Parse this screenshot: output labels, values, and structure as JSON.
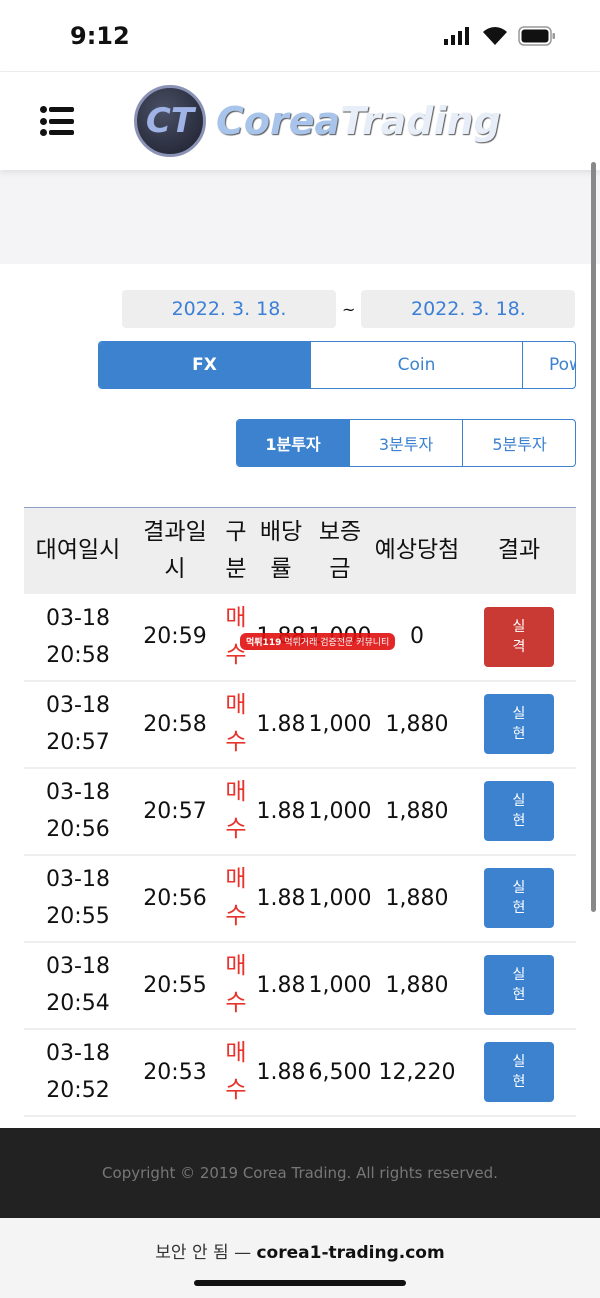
{
  "status": {
    "time": "9:12"
  },
  "header": {
    "logo_mark": "CT",
    "brand_a": "Corea",
    "brand_b": "Trading"
  },
  "dates": {
    "from": "2022. 3. 18.",
    "sep": "~",
    "to": "2022. 3. 18."
  },
  "tabs": [
    {
      "label": "FX",
      "active": true
    },
    {
      "label": "Coin"
    },
    {
      "label": "Pow"
    }
  ],
  "subtabs": [
    {
      "label": "1분투자",
      "active": true
    },
    {
      "label": "3분투자"
    },
    {
      "label": "5분투자"
    }
  ],
  "table": {
    "headers": [
      "대여일시",
      "결과일시",
      "구분",
      "배당률",
      "보증금",
      "예상당첨",
      "결과"
    ],
    "rows": [
      {
        "date": "03-18",
        "time": "20:58",
        "result_time": "20:59",
        "type": "매수",
        "rate": "1.88",
        "deposit": "1,000",
        "expected": "0",
        "result": "실격",
        "status": "fail"
      },
      {
        "date": "03-18",
        "time": "20:57",
        "result_time": "20:58",
        "type": "매수",
        "rate": "1.88",
        "deposit": "1,000",
        "expected": "1,880",
        "result": "실현",
        "status": "win"
      },
      {
        "date": "03-18",
        "time": "20:56",
        "result_time": "20:57",
        "type": "매수",
        "rate": "1.88",
        "deposit": "1,000",
        "expected": "1,880",
        "result": "실현",
        "status": "win"
      },
      {
        "date": "03-18",
        "time": "20:55",
        "result_time": "20:56",
        "type": "매수",
        "rate": "1.88",
        "deposit": "1,000",
        "expected": "1,880",
        "result": "실현",
        "status": "win"
      },
      {
        "date": "03-18",
        "time": "20:54",
        "result_time": "20:55",
        "type": "매수",
        "rate": "1.88",
        "deposit": "1,000",
        "expected": "1,880",
        "result": "실현",
        "status": "win"
      },
      {
        "date": "03-18",
        "time": "20:52",
        "result_time": "20:53",
        "type": "매수",
        "rate": "1.88",
        "deposit": "6,500",
        "expected": "12,220",
        "result": "실현",
        "status": "win"
      }
    ]
  },
  "watermark": {
    "title": "먹튀119",
    "subtitle": "먹튀거래 검증전문 커뮤니티"
  },
  "footer": {
    "copyright": "Copyright © 2019 Corea Trading. All rights reserved."
  },
  "browser": {
    "security": "보안 안 됨 —",
    "url": "corea1-trading.com"
  },
  "colors": {
    "accent": "#3c82cf",
    "fail": "#c93a35",
    "buy": "#e8322c"
  }
}
